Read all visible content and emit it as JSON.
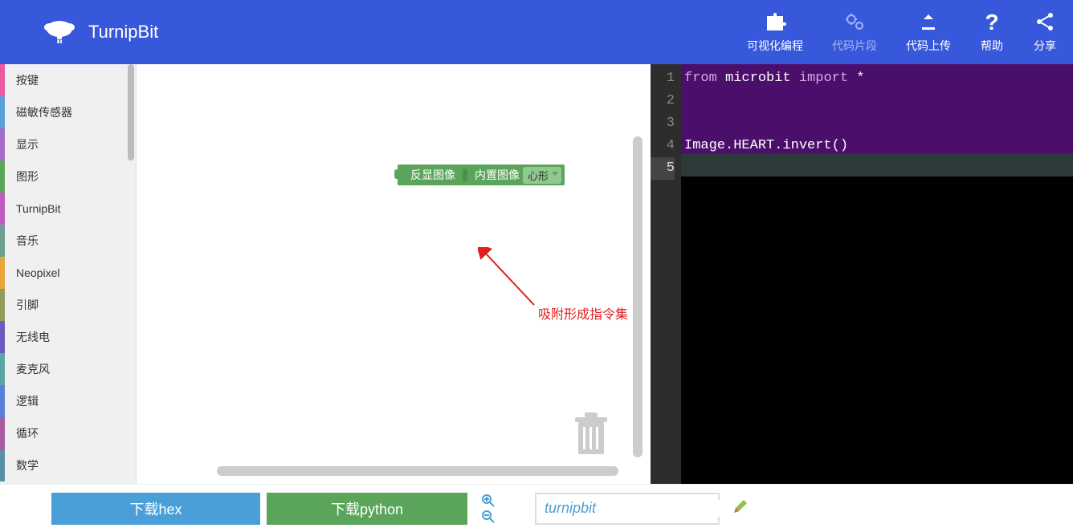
{
  "header": {
    "logo_text": "TurnipBit",
    "nav": [
      {
        "label": "可视化编程",
        "icon": "puzzle-icon",
        "dimmed": false
      },
      {
        "label": "代码片段",
        "icon": "gears-icon",
        "dimmed": true
      },
      {
        "label": "代码上传",
        "icon": "upload-icon",
        "dimmed": false
      },
      {
        "label": "帮助",
        "icon": "question-icon",
        "dimmed": false
      },
      {
        "label": "分享",
        "icon": "share-icon",
        "dimmed": false
      }
    ]
  },
  "sidebar": {
    "items": [
      {
        "label": "按键",
        "color": "#e85d9e"
      },
      {
        "label": "磁敏传感器",
        "color": "#5a9ed8"
      },
      {
        "label": "显示",
        "color": "#a56bc9"
      },
      {
        "label": "图形",
        "color": "#5ba55b"
      },
      {
        "label": "TurnipBit",
        "color": "#c15bc1"
      },
      {
        "label": "音乐",
        "color": "#6b9f8f"
      },
      {
        "label": "Neopixel",
        "color": "#e8a53a"
      },
      {
        "label": "引脚",
        "color": "#8f9f5b"
      },
      {
        "label": "无线电",
        "color": "#6b5abf"
      },
      {
        "label": "麦克风",
        "color": "#5ba5a5"
      },
      {
        "label": "逻辑",
        "color": "#5a7fd8"
      },
      {
        "label": "循环",
        "color": "#a55b9e"
      },
      {
        "label": "数学",
        "color": "#5b8fa5"
      }
    ]
  },
  "workspace": {
    "block": {
      "left_label": "反显图像",
      "right_label": "内置图像",
      "dropdown_value": "心形"
    },
    "annotation": "吸附形成指令集"
  },
  "code": {
    "lines": [
      {
        "num": "1",
        "tokens": [
          {
            "t": "from ",
            "c": "kw"
          },
          {
            "t": "microbit ",
            "c": "id"
          },
          {
            "t": "import ",
            "c": "kw"
          },
          {
            "t": "*",
            "c": "op"
          }
        ]
      },
      {
        "num": "2",
        "tokens": []
      },
      {
        "num": "3",
        "tokens": []
      },
      {
        "num": "4",
        "tokens": [
          {
            "t": "Image.HEART.invert()",
            "c": "id"
          }
        ]
      },
      {
        "num": "5",
        "tokens": []
      }
    ]
  },
  "footer": {
    "hex_label": "下载hex",
    "python_label": "下载python",
    "filename": "turnipbit"
  }
}
